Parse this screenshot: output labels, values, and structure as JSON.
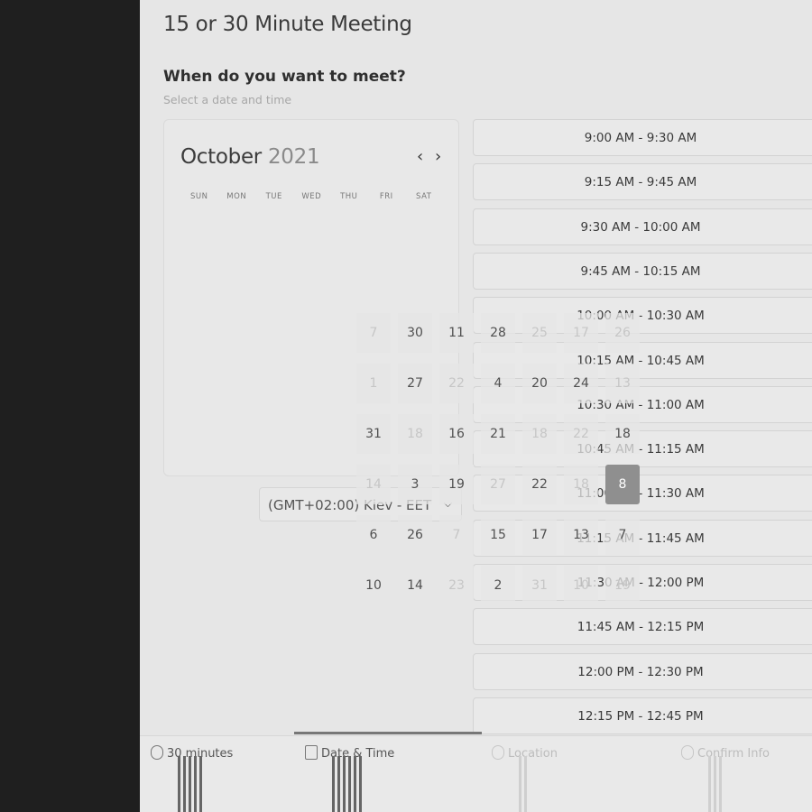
{
  "page": {
    "title": "15 or 30 Minute Meeting",
    "question": "When do you want to meet?",
    "hint": "Select a date and time"
  },
  "calendar": {
    "month": "October",
    "year": "2021",
    "prev_icon": "chevron-left-icon",
    "next_icon": "chevron-right-icon",
    "weekdays": [
      "SUN",
      "MON",
      "TUE",
      "WED",
      "THU",
      "FRI",
      "SAT"
    ],
    "days": [
      {
        "label": "7",
        "dim": true
      },
      {
        "label": "30",
        "dim": false
      },
      {
        "label": "11",
        "dim": false
      },
      {
        "label": "28",
        "dim": false
      },
      {
        "label": "25",
        "dim": true
      },
      {
        "label": "17",
        "dim": true
      },
      {
        "label": "26",
        "dim": true
      },
      {
        "label": "1",
        "dim": true
      },
      {
        "label": "27",
        "dim": false
      },
      {
        "label": "22",
        "dim": true
      },
      {
        "label": "4",
        "dim": false
      },
      {
        "label": "20",
        "dim": false
      },
      {
        "label": "24",
        "dim": false
      },
      {
        "label": "13",
        "dim": true
      },
      {
        "label": "31",
        "dim": false
      },
      {
        "label": "18",
        "dim": true
      },
      {
        "label": "16",
        "dim": false
      },
      {
        "label": "21",
        "dim": false
      },
      {
        "label": "18",
        "dim": true
      },
      {
        "label": "22",
        "dim": true
      },
      {
        "label": "18",
        "dim": false
      },
      {
        "label": "14",
        "dim": true
      },
      {
        "label": "3",
        "dim": false
      },
      {
        "label": "19",
        "dim": false
      },
      {
        "label": "27",
        "dim": true
      },
      {
        "label": "22",
        "dim": false
      },
      {
        "label": "18",
        "dim": true
      },
      {
        "label": "8",
        "dim": false,
        "selected": true
      },
      {
        "label": "6",
        "dim": false
      },
      {
        "label": "26",
        "dim": false
      },
      {
        "label": "7",
        "dim": true
      },
      {
        "label": "15",
        "dim": false
      },
      {
        "label": "17",
        "dim": false
      },
      {
        "label": "13",
        "dim": false
      },
      {
        "label": "7",
        "dim": false
      },
      {
        "label": "10",
        "dim": false
      },
      {
        "label": "14",
        "dim": false
      },
      {
        "label": "23",
        "dim": true
      },
      {
        "label": "2",
        "dim": false
      },
      {
        "label": "31",
        "dim": true
      },
      {
        "label": "10",
        "dim": true
      },
      {
        "label": "19",
        "dim": true
      }
    ]
  },
  "timezone": {
    "value": "(GMT+02:00) Kiev - EET",
    "icon": "chevron-down-icon"
  },
  "slots": [
    "9:00 AM - 9:30 AM",
    "9:15 AM - 9:45 AM",
    "9:30 AM - 10:00 AM",
    "9:45 AM - 10:15 AM",
    "10:00 AM - 10:30 AM",
    "10:15 AM - 10:45 AM",
    "10:30 AM - 11:00 AM",
    "10:45 AM - 11:15 AM",
    "11:00 AM - 11:30 AM",
    "11:15 AM - 11:45 AM",
    "11:30 AM - 12:00 PM",
    "11:45 AM - 12:15 PM",
    "12:00 PM - 12:30 PM",
    "12:15 PM - 12:45 PM"
  ],
  "steps": [
    {
      "label": "30 minutes",
      "icon": "clock-icon",
      "active": false
    },
    {
      "label": "Date & Time",
      "icon": "calendar-icon",
      "active": true
    },
    {
      "label": "Location",
      "icon": "location-pin-icon",
      "active": false
    },
    {
      "label": "Confirm Info",
      "icon": "checkbox-icon",
      "active": false
    }
  ]
}
